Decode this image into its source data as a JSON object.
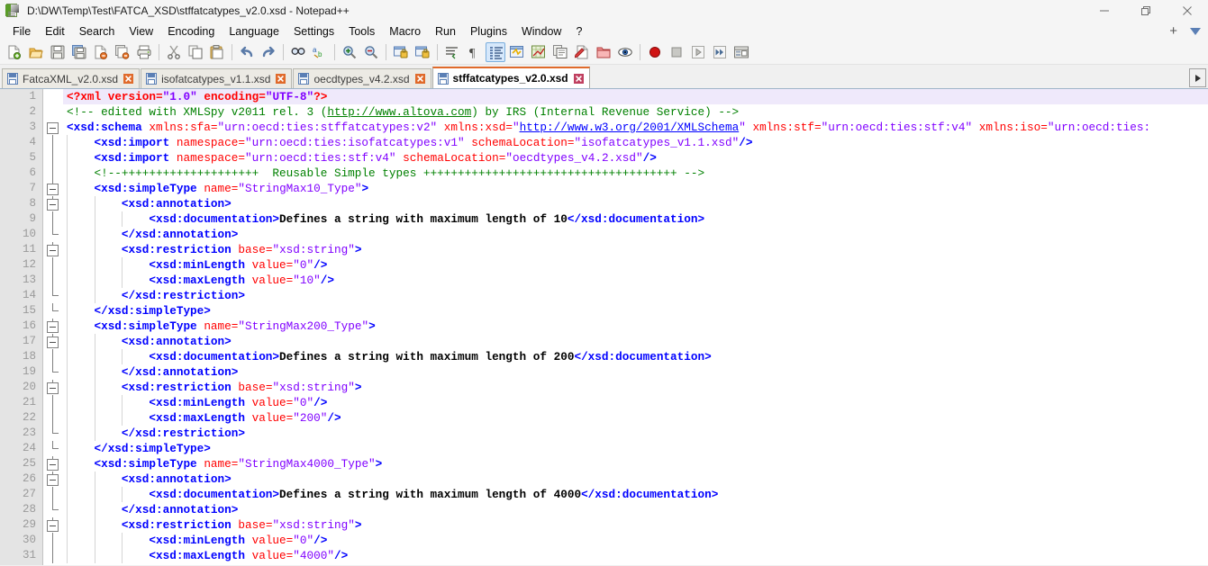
{
  "window": {
    "title": "D:\\DW\\Temp\\Test\\FATCA_XSD\\stffatcatypes_v2.0.xsd - Notepad++",
    "app_icon": "notepad-plus-plus-icon",
    "minimize_label": "—",
    "maximize_label": "❐",
    "close_label": "✕"
  },
  "menubar": {
    "items": [
      {
        "label": "File"
      },
      {
        "label": "Edit"
      },
      {
        "label": "Search"
      },
      {
        "label": "View"
      },
      {
        "label": "Encoding"
      },
      {
        "label": "Language"
      },
      {
        "label": "Settings"
      },
      {
        "label": "Tools"
      },
      {
        "label": "Macro"
      },
      {
        "label": "Run"
      },
      {
        "label": "Plugins"
      },
      {
        "label": "Window"
      },
      {
        "label": "?"
      }
    ],
    "plus_label": "+",
    "dropdown_icon": "chevron-down-icon"
  },
  "toolbar": {
    "buttons": [
      {
        "name": "new-file-icon",
        "title": "New"
      },
      {
        "name": "open-file-icon",
        "title": "Open"
      },
      {
        "name": "save-icon",
        "title": "Save"
      },
      {
        "name": "save-all-icon",
        "title": "Save All"
      },
      {
        "name": "close-file-icon",
        "title": "Close"
      },
      {
        "name": "close-all-icon",
        "title": "Close All"
      },
      {
        "name": "print-icon",
        "title": "Print"
      },
      {
        "name": "separator",
        "title": ""
      },
      {
        "name": "cut-icon",
        "title": "Cut"
      },
      {
        "name": "copy-icon",
        "title": "Copy"
      },
      {
        "name": "paste-icon",
        "title": "Paste"
      },
      {
        "name": "separator",
        "title": ""
      },
      {
        "name": "undo-icon",
        "title": "Undo"
      },
      {
        "name": "redo-icon",
        "title": "Redo"
      },
      {
        "name": "separator",
        "title": ""
      },
      {
        "name": "find-icon",
        "title": "Find"
      },
      {
        "name": "replace-icon",
        "title": "Replace"
      },
      {
        "name": "separator",
        "title": ""
      },
      {
        "name": "zoom-in-icon",
        "title": "Zoom In"
      },
      {
        "name": "zoom-out-icon",
        "title": "Zoom Out"
      },
      {
        "name": "separator",
        "title": ""
      },
      {
        "name": "sync-vertical-icon",
        "title": "Synchronize Vertical Scrolling"
      },
      {
        "name": "sync-horizontal-icon",
        "title": "Synchronize Horizontal Scrolling"
      },
      {
        "name": "separator",
        "title": ""
      },
      {
        "name": "word-wrap-icon",
        "title": "Word wrap"
      },
      {
        "name": "show-all-chars-icon",
        "title": "Show All Characters"
      },
      {
        "name": "indent-guide-icon",
        "title": "Show Indent Guide"
      },
      {
        "name": "user-defined-dialog-icon",
        "title": "User-Defined Dialogue"
      },
      {
        "name": "document-map-icon",
        "title": "Document Map"
      },
      {
        "name": "function-list-icon",
        "title": "Function List"
      },
      {
        "name": "macro-play-icon",
        "title": "Play Macro"
      },
      {
        "name": "folder-workspace-icon",
        "title": "Folder as Workspace"
      },
      {
        "name": "monitoring-icon",
        "title": "Monitoring"
      },
      {
        "name": "separator",
        "title": ""
      },
      {
        "name": "record-macro-icon",
        "title": "Start Recording"
      },
      {
        "name": "stop-macro-icon",
        "title": "Stop Recording"
      },
      {
        "name": "playback-macro-icon",
        "title": "Playback"
      },
      {
        "name": "run-multiple-macro-icon",
        "title": "Run a Macro Multiple Times"
      },
      {
        "name": "save-macro-icon",
        "title": "Save Current Recorded Macro"
      }
    ]
  },
  "tabs": {
    "items": [
      {
        "label": "FatcaXML_v2.0.xsd",
        "active": false,
        "icon": "saved-file-icon",
        "close": "close-icon"
      },
      {
        "label": "isofatcatypes_v1.1.xsd",
        "active": false,
        "icon": "saved-file-icon",
        "close": "close-icon"
      },
      {
        "label": "oecdtypes_v4.2.xsd",
        "active": false,
        "icon": "saved-file-icon",
        "close": "close-icon"
      },
      {
        "label": "stffatcatypes_v2.0.xsd",
        "active": true,
        "icon": "saved-file-icon",
        "close": "close-icon"
      }
    ],
    "scroll_right_icon": "arrow-right-icon"
  },
  "editor": {
    "current_line": 1,
    "colors": {
      "tag": "#0000ff",
      "attribute": "#ff0000",
      "value": "#8000ff",
      "comment": "#008000",
      "text": "#000000",
      "line_number": "#9a9a9a",
      "gutter_bg": "#e4e4e4",
      "current_line_bg": "#efe9fb",
      "editor_bg": "#ffffff",
      "active_tab_accent": "#e06a2b"
    },
    "line_numbers": [
      1,
      2,
      3,
      4,
      5,
      6,
      7,
      8,
      9,
      10,
      11,
      12,
      13,
      14,
      15,
      16,
      17,
      18,
      19,
      20,
      21,
      22,
      23,
      24,
      25,
      26,
      27,
      28,
      29,
      30,
      31
    ],
    "lines": [
      {
        "n": 1,
        "fold": "none",
        "indent_guides": 0,
        "text": "<?xml version=\"1.0\" encoding=\"UTF-8\"?>"
      },
      {
        "n": 2,
        "fold": "none",
        "indent_guides": 0,
        "text": "<!-- edited with XMLSpy v2011 rel. 3 (http://www.altova.com) by IRS (Internal Revenue Service) -->"
      },
      {
        "n": 3,
        "fold": "open",
        "indent_guides": 0,
        "text": "<xsd:schema xmlns:sfa=\"urn:oecd:ties:stffatcatypes:v2\" xmlns:xsd=\"http://www.w3.org/2001/XMLSchema\" xmlns:stf=\"urn:oecd:ties:stf:v4\" xmlns:iso=\"urn:oecd:ties:"
      },
      {
        "n": 4,
        "fold": "line",
        "indent_guides": 1,
        "text": "    <xsd:import namespace=\"urn:oecd:ties:isofatcatypes:v1\" schemaLocation=\"isofatcatypes_v1.1.xsd\"/>"
      },
      {
        "n": 5,
        "fold": "line",
        "indent_guides": 1,
        "text": "    <xsd:import namespace=\"urn:oecd:ties:stf:v4\" schemaLocation=\"oecdtypes_v4.2.xsd\"/>"
      },
      {
        "n": 6,
        "fold": "line",
        "indent_guides": 1,
        "text": "    <!--++++++++++++++++++++  Reusable Simple types +++++++++++++++++++++++++++++++++++++ -->"
      },
      {
        "n": 7,
        "fold": "open",
        "indent_guides": 1,
        "text": "    <xsd:simpleType name=\"StringMax10_Type\">"
      },
      {
        "n": 8,
        "fold": "open",
        "indent_guides": 2,
        "text": "        <xsd:annotation>"
      },
      {
        "n": 9,
        "fold": "line",
        "indent_guides": 3,
        "text": "            <xsd:documentation>Defines a string with maximum length of 10</xsd:documentation>"
      },
      {
        "n": 10,
        "fold": "end",
        "indent_guides": 2,
        "text": "        </xsd:annotation>"
      },
      {
        "n": 11,
        "fold": "open",
        "indent_guides": 2,
        "text": "        <xsd:restriction base=\"xsd:string\">"
      },
      {
        "n": 12,
        "fold": "line",
        "indent_guides": 3,
        "text": "            <xsd:minLength value=\"0\"/>"
      },
      {
        "n": 13,
        "fold": "line",
        "indent_guides": 3,
        "text": "            <xsd:maxLength value=\"10\"/>"
      },
      {
        "n": 14,
        "fold": "end",
        "indent_guides": 2,
        "text": "        </xsd:restriction>"
      },
      {
        "n": 15,
        "fold": "end",
        "indent_guides": 1,
        "text": "    </xsd:simpleType>"
      },
      {
        "n": 16,
        "fold": "open",
        "indent_guides": 1,
        "text": "    <xsd:simpleType name=\"StringMax200_Type\">"
      },
      {
        "n": 17,
        "fold": "open",
        "indent_guides": 2,
        "text": "        <xsd:annotation>"
      },
      {
        "n": 18,
        "fold": "line",
        "indent_guides": 3,
        "text": "            <xsd:documentation>Defines a string with maximum length of 200</xsd:documentation>"
      },
      {
        "n": 19,
        "fold": "end",
        "indent_guides": 2,
        "text": "        </xsd:annotation>"
      },
      {
        "n": 20,
        "fold": "open",
        "indent_guides": 2,
        "text": "        <xsd:restriction base=\"xsd:string\">"
      },
      {
        "n": 21,
        "fold": "line",
        "indent_guides": 3,
        "text": "            <xsd:minLength value=\"0\"/>"
      },
      {
        "n": 22,
        "fold": "line",
        "indent_guides": 3,
        "text": "            <xsd:maxLength value=\"200\"/>"
      },
      {
        "n": 23,
        "fold": "end",
        "indent_guides": 2,
        "text": "        </xsd:restriction>"
      },
      {
        "n": 24,
        "fold": "end",
        "indent_guides": 1,
        "text": "    </xsd:simpleType>"
      },
      {
        "n": 25,
        "fold": "open",
        "indent_guides": 1,
        "text": "    <xsd:simpleType name=\"StringMax4000_Type\">"
      },
      {
        "n": 26,
        "fold": "open",
        "indent_guides": 2,
        "text": "        <xsd:annotation>"
      },
      {
        "n": 27,
        "fold": "line",
        "indent_guides": 3,
        "text": "            <xsd:documentation>Defines a string with maximum length of 4000</xsd:documentation>"
      },
      {
        "n": 28,
        "fold": "end",
        "indent_guides": 2,
        "text": "        </xsd:annotation>"
      },
      {
        "n": 29,
        "fold": "open",
        "indent_guides": 2,
        "text": "        <xsd:restriction base=\"xsd:string\">"
      },
      {
        "n": 30,
        "fold": "line",
        "indent_guides": 3,
        "text": "            <xsd:minLength value=\"0\"/>"
      },
      {
        "n": 31,
        "fold": "line",
        "indent_guides": 3,
        "text": "            <xsd:maxLength value=\"4000\"/>"
      }
    ],
    "html_lines": [
      "<span class=\"t-pi\">&lt;?xml</span> <span class=\"t-pi\">version=</span><span class=\"t-piv\">\"1.0\"</span> <span class=\"t-pi\">encoding=</span><span class=\"t-piv\">\"UTF-8\"</span><span class=\"t-pi\">?&gt;</span>",
      "<span class=\"t-cmt\">&lt;!-- edited with XMLSpy v2011 rel. 3 (</span><span class=\"t-link-g\">http://www.altova.com</span><span class=\"t-cmt\">) by IRS (Internal Revenue Service) --&gt;</span>",
      "<span class=\"t-tag\">&lt;xsd:schema</span> <span class=\"t-attr\">xmlns:sfa=</span><span class=\"t-val\">\"urn:oecd:ties:stffatcatypes:v2\"</span> <span class=\"t-attr\">xmlns:xsd=</span><span class=\"t-val\">\"</span><span class=\"t-link\">http://www.w3.org/2001/XMLSchema</span><span class=\"t-val\">\"</span> <span class=\"t-attr\">xmlns:stf=</span><span class=\"t-val\">\"urn:oecd:ties:stf:v4\"</span> <span class=\"t-attr\">xmlns:iso=</span><span class=\"t-val\">\"urn:oecd:ties:</span>",
      "    <span class=\"t-tag\">&lt;xsd:import</span> <span class=\"t-attr\">namespace=</span><span class=\"t-val\">\"urn:oecd:ties:isofatcatypes:v1\"</span> <span class=\"t-attr\">schemaLocation=</span><span class=\"t-val\">\"isofatcatypes_v1.1.xsd\"</span><span class=\"t-tag\">/&gt;</span>",
      "    <span class=\"t-tag\">&lt;xsd:import</span> <span class=\"t-attr\">namespace=</span><span class=\"t-val\">\"urn:oecd:ties:stf:v4\"</span> <span class=\"t-attr\">schemaLocation=</span><span class=\"t-val\">\"oecdtypes_v4.2.xsd\"</span><span class=\"t-tag\">/&gt;</span>",
      "    <span class=\"t-cmt\">&lt;!--++++++++++++++++++++  Reusable Simple types +++++++++++++++++++++++++++++++++++++ --&gt;</span>",
      "    <span class=\"t-tag\">&lt;xsd:simpleType</span> <span class=\"t-attr\">name=</span><span class=\"t-val\">\"StringMax10_Type\"</span><span class=\"t-tag\">&gt;</span>",
      "        <span class=\"t-tag\">&lt;xsd:annotation&gt;</span>",
      "            <span class=\"t-tag\">&lt;xsd:documentation&gt;</span><span class=\"t-txt\">Defines a string with maximum length of 10</span><span class=\"t-tag\">&lt;/xsd:documentation&gt;</span>",
      "        <span class=\"t-tag\">&lt;/xsd:annotation&gt;</span>",
      "        <span class=\"t-tag\">&lt;xsd:restriction</span> <span class=\"t-attr\">base=</span><span class=\"t-val\">\"xsd:string\"</span><span class=\"t-tag\">&gt;</span>",
      "            <span class=\"t-tag\">&lt;xsd:minLength</span> <span class=\"t-attr\">value=</span><span class=\"t-val\">\"0\"</span><span class=\"t-tag\">/&gt;</span>",
      "            <span class=\"t-tag\">&lt;xsd:maxLength</span> <span class=\"t-attr\">value=</span><span class=\"t-val\">\"10\"</span><span class=\"t-tag\">/&gt;</span>",
      "        <span class=\"t-tag\">&lt;/xsd:restriction&gt;</span>",
      "    <span class=\"t-tag\">&lt;/xsd:simpleType&gt;</span>",
      "    <span class=\"t-tag\">&lt;xsd:simpleType</span> <span class=\"t-attr\">name=</span><span class=\"t-val\">\"StringMax200_Type\"</span><span class=\"t-tag\">&gt;</span>",
      "        <span class=\"t-tag\">&lt;xsd:annotation&gt;</span>",
      "            <span class=\"t-tag\">&lt;xsd:documentation&gt;</span><span class=\"t-txt\">Defines a string with maximum length of 200</span><span class=\"t-tag\">&lt;/xsd:documentation&gt;</span>",
      "        <span class=\"t-tag\">&lt;/xsd:annotation&gt;</span>",
      "        <span class=\"t-tag\">&lt;xsd:restriction</span> <span class=\"t-attr\">base=</span><span class=\"t-val\">\"xsd:string\"</span><span class=\"t-tag\">&gt;</span>",
      "            <span class=\"t-tag\">&lt;xsd:minLength</span> <span class=\"t-attr\">value=</span><span class=\"t-val\">\"0\"</span><span class=\"t-tag\">/&gt;</span>",
      "            <span class=\"t-tag\">&lt;xsd:maxLength</span> <span class=\"t-attr\">value=</span><span class=\"t-val\">\"200\"</span><span class=\"t-tag\">/&gt;</span>",
      "        <span class=\"t-tag\">&lt;/xsd:restriction&gt;</span>",
      "    <span class=\"t-tag\">&lt;/xsd:simpleType&gt;</span>",
      "    <span class=\"t-tag\">&lt;xsd:simpleType</span> <span class=\"t-attr\">name=</span><span class=\"t-val\">\"StringMax4000_Type\"</span><span class=\"t-tag\">&gt;</span>",
      "        <span class=\"t-tag\">&lt;xsd:annotation&gt;</span>",
      "            <span class=\"t-tag\">&lt;xsd:documentation&gt;</span><span class=\"t-txt\">Defines a string with maximum length of 4000</span><span class=\"t-tag\">&lt;/xsd:documentation&gt;</span>",
      "        <span class=\"t-tag\">&lt;/xsd:annotation&gt;</span>",
      "        <span class=\"t-tag\">&lt;xsd:restriction</span> <span class=\"t-attr\">base=</span><span class=\"t-val\">\"xsd:string\"</span><span class=\"t-tag\">&gt;</span>",
      "            <span class=\"t-tag\">&lt;xsd:minLength</span> <span class=\"t-attr\">value=</span><span class=\"t-val\">\"0\"</span><span class=\"t-tag\">/&gt;</span>",
      "            <span class=\"t-tag\">&lt;xsd:maxLength</span> <span class=\"t-attr\">value=</span><span class=\"t-val\">\"4000\"</span><span class=\"t-tag\">/&gt;</span>"
    ]
  }
}
